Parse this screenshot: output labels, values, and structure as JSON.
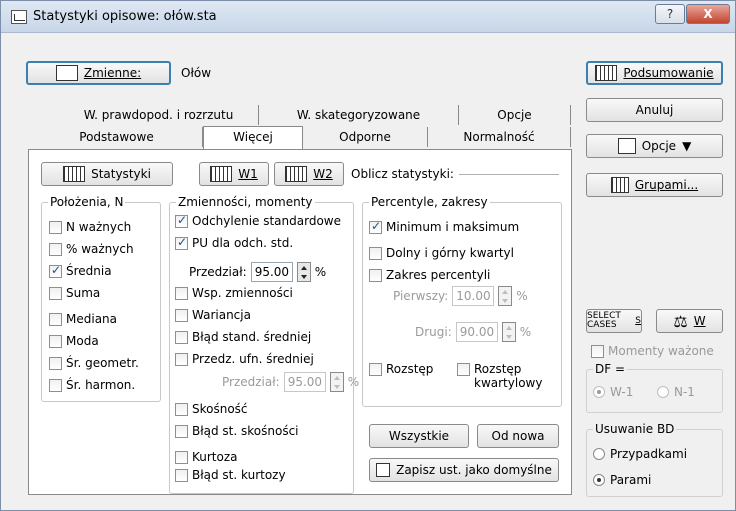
{
  "window": {
    "title": "Statystyki opisowe: ołów.sta",
    "help": "?",
    "close": "X"
  },
  "variables": {
    "button_label": "Zmienne:",
    "value": "Ołów"
  },
  "tabs": {
    "top": [
      "W. prawdopod. i rozrzutu",
      "W. skategoryzowane",
      "Opcje"
    ],
    "bottom": [
      "Podstawowe",
      "Więcej",
      "Odporne",
      "Normalność"
    ]
  },
  "toolbar": {
    "statystyki": "Statystyki",
    "w1": "W1",
    "w2": "W2",
    "oblicz": "Oblicz statystyki:"
  },
  "groups": {
    "polozenia": {
      "title": "Położenia, N",
      "items": [
        {
          "label": "N ważnych",
          "checked": false
        },
        {
          "label": "% ważnych",
          "checked": false
        },
        {
          "label": "Średnia",
          "checked": true
        },
        {
          "label": "Suma",
          "checked": false
        },
        {
          "label": "Mediana",
          "checked": false
        },
        {
          "label": "Moda",
          "checked": false
        },
        {
          "label": "Śr. geometr.",
          "checked": false
        },
        {
          "label": "Śr. harmon.",
          "checked": false
        }
      ]
    },
    "zmiennosci": {
      "title": "Zmienności, momenty",
      "items": [
        {
          "label": "Odchylenie standardowe",
          "checked": true
        },
        {
          "label": "PU dla odch. std.",
          "checked": true
        },
        {
          "label": "Wsp. zmienności",
          "checked": false
        },
        {
          "label": "Wariancja",
          "checked": false
        },
        {
          "label": "Błąd stand. średniej",
          "checked": false
        },
        {
          "label": "Przedz. ufn. średniej",
          "checked": false
        },
        {
          "label": "Skośność",
          "checked": false
        },
        {
          "label": "Błąd st. skośności",
          "checked": false
        },
        {
          "label": "Kurtoza",
          "checked": false
        },
        {
          "label": "Błąd st. kurtozy",
          "checked": false
        }
      ],
      "przedzial_label": "Przedział:",
      "przedzial1_value": "95.00",
      "przedzial2_value": "95.00",
      "percent": "%"
    },
    "percentyle": {
      "title": "Percentyle, zakresy",
      "items": [
        {
          "label": "Minimum i maksimum",
          "checked": true
        },
        {
          "label": "Dolny i górny kwartyl",
          "checked": false
        },
        {
          "label": "Zakres percentyli",
          "checked": false
        }
      ],
      "pierwszy_label": "Pierwszy:",
      "pierwszy_value": "10.00",
      "drugi_label": "Drugi:",
      "drugi_value": "90.00",
      "percent": "%",
      "rozstep": "Rozstęp",
      "rozstep_kw_1": "Rozstęp",
      "rozstep_kw_2": "kwartylowy"
    }
  },
  "buttons": {
    "wszystkie": "Wszystkie",
    "od_nowa": "Od nowa",
    "zapisz": "Zapisz ust. jako domyślne",
    "podsumowanie": "Podsumowanie",
    "anuluj": "Anuluj",
    "opcje": "Opcje",
    "grupami": "Grupami...",
    "select_cases": "SELECT CASES",
    "s": "S",
    "w": "W"
  },
  "right_panel": {
    "momenty": "Momenty ważone",
    "df_title": "DF =",
    "df_w1": "W-1",
    "df_n1": "N-1",
    "usuwanie_title": "Usuwanie BD",
    "przypadkami": "Przypadkami",
    "parami": "Parami"
  }
}
